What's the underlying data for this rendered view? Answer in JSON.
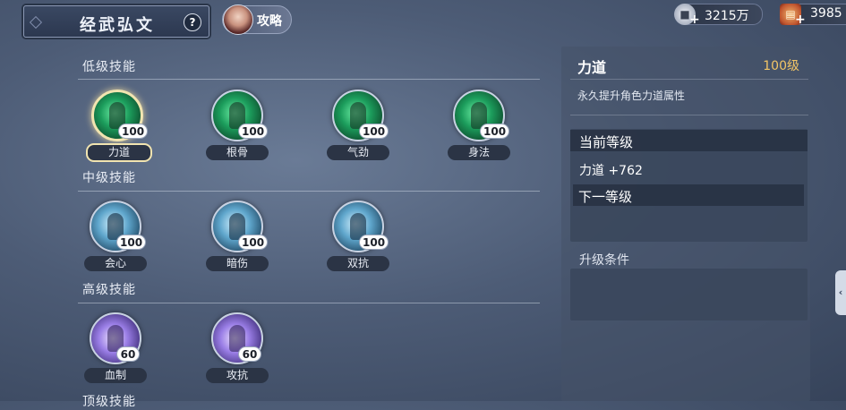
{
  "header": {
    "title": "经武弘文",
    "help_label": "?",
    "guide_label": "攻略"
  },
  "resources": [
    {
      "icon": "coin-icon",
      "value": "3215万"
    },
    {
      "icon": "scroll-icon",
      "value": "3985"
    }
  ],
  "sections": [
    {
      "label": "低级技能",
      "skills": [
        {
          "name": "力道",
          "level": "100",
          "selected": true
        },
        {
          "name": "根骨",
          "level": "100"
        },
        {
          "name": "气劲",
          "level": "100"
        },
        {
          "name": "身法",
          "level": "100"
        }
      ]
    },
    {
      "label": "中级技能",
      "skills": [
        {
          "name": "会心",
          "level": "100"
        },
        {
          "name": "暗伤",
          "level": "100"
        },
        {
          "name": "双抗",
          "level": "100"
        }
      ]
    },
    {
      "label": "高级技能",
      "skills": [
        {
          "name": "血制",
          "level": "60"
        },
        {
          "name": "攻抗",
          "level": "60"
        }
      ]
    },
    {
      "label": "顶级技能",
      "skills": []
    }
  ],
  "detail": {
    "name": "力道",
    "level": "100级",
    "description": "永久提升角色力道属性",
    "current_level_label": "当前等级",
    "current_stat": "力道 +762",
    "next_level_label": "下一等级",
    "upgrade_label": "升级条件"
  },
  "colors": {
    "accent_gold": "#f2c566",
    "selected_ring": "#f1e4b0"
  }
}
